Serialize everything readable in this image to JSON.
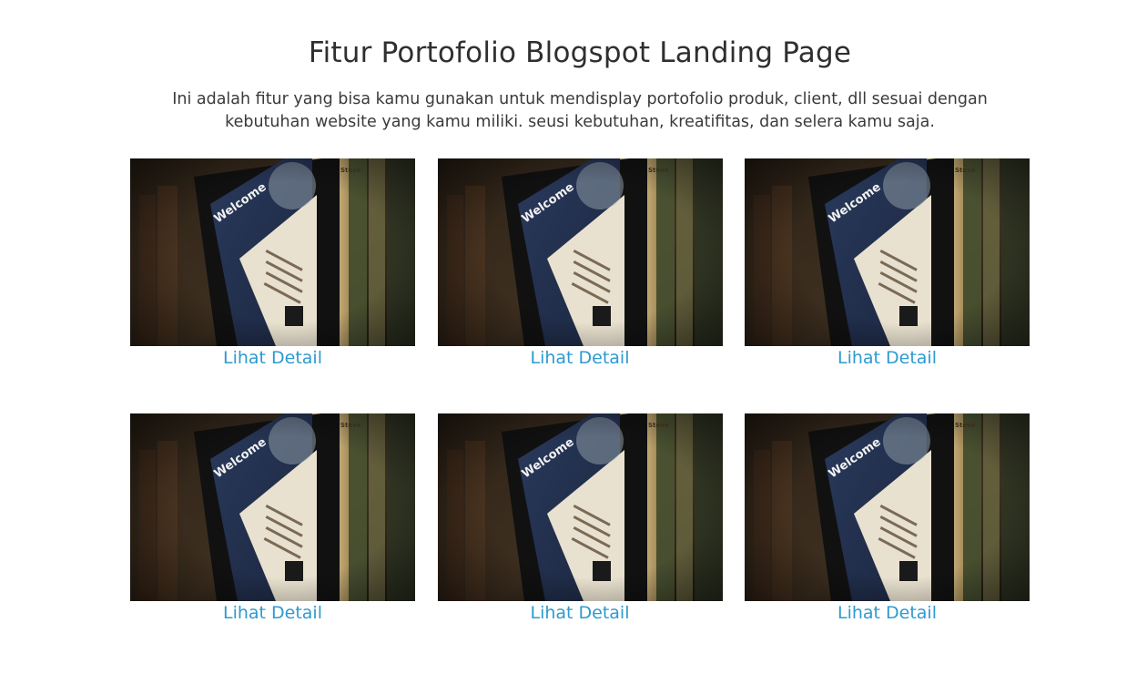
{
  "section": {
    "title": "Fitur Portofolio Blogspot Landing Page",
    "description": "Ini adalah fitur yang bisa kamu gunakan untuk mendisplay portofolio produk, client, dll sesuai dengan kebutuhan website yang kamu miliki. seusi kebutuhan, kreatifitas, dan selera kamu saja."
  },
  "portfolio": {
    "items": [
      {
        "link_label": "Lihat Detail",
        "image": {
          "screen_title": "Welcome",
          "corner_label": "Steve"
        }
      },
      {
        "link_label": "Lihat Detail",
        "image": {
          "screen_title": "Welcome",
          "corner_label": "Steve"
        }
      },
      {
        "link_label": "Lihat Detail",
        "image": {
          "screen_title": "Welcome",
          "corner_label": "Steve"
        }
      },
      {
        "link_label": "Lihat Detail",
        "image": {
          "screen_title": "Welcome",
          "corner_label": "Steve"
        }
      },
      {
        "link_label": "Lihat Detail",
        "image": {
          "screen_title": "Welcome",
          "corner_label": "Steve"
        }
      },
      {
        "link_label": "Lihat Detail",
        "image": {
          "screen_title": "Welcome",
          "corner_label": "Steve"
        }
      }
    ]
  },
  "colors": {
    "link": "#2e9ad0",
    "heading": "#2f2f2f",
    "text": "#3a3a3a"
  }
}
